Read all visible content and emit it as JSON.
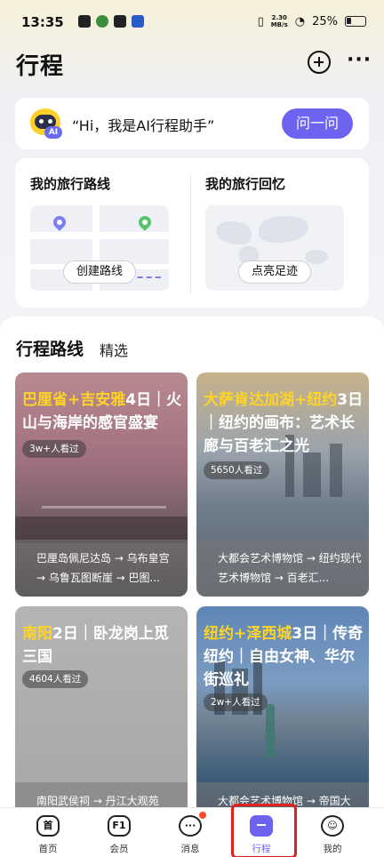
{
  "status_bar": {
    "time": "13:35",
    "speed": "2.30\nMB/s",
    "battery": "25%"
  },
  "header": {
    "title": "行程"
  },
  "ai_assistant": {
    "greeting": "“Hi，我是AI行程助手”",
    "badge": "AI",
    "ask_label": "问一问"
  },
  "trip": {
    "routes": {
      "title": "我的旅行路线",
      "button": "创建路线"
    },
    "memories": {
      "title": "我的旅行回忆",
      "button": "点亮足迹"
    }
  },
  "tabs": {
    "active": "行程路线",
    "other": "精选"
  },
  "guides": [
    {
      "hl": "巴厘省+吉安雅",
      "rest": "4日｜火山与海岸的感官盛宴",
      "views": "3w+人看过",
      "route": "巴厘岛佩尼达岛 → 乌布皇宫 → 乌鲁瓦图断崖 → 巴图..."
    },
    {
      "hl": "大萨肯达加湖+纽约",
      "rest": "3日｜纽约的画布：艺术长廊与百老汇之光",
      "views": "5650人看过",
      "route": "大都会艺术博物馆 → 纽约现代艺术博物馆 → 百老汇..."
    },
    {
      "hl": "南阳",
      "rest": "2日｜卧龙岗上觅三国",
      "views": "4604人看过",
      "route": "南阳武侯祠 → 丹江大观苑"
    },
    {
      "hl": "纽约+泽西城",
      "rest": "3日｜传奇纽约｜自由女神、华尔街巡礼",
      "views": "2w+人看过",
      "route": "大都会艺术博物馆 → 帝国大"
    }
  ],
  "nav": [
    {
      "label": "首页",
      "icon": "home-icon",
      "glyph": "首"
    },
    {
      "label": "会员",
      "icon": "member-icon",
      "glyph": "F1"
    },
    {
      "label": "消息",
      "icon": "message-icon",
      "glyph": "···"
    },
    {
      "label": "行程",
      "icon": "trip-icon",
      "glyph": ""
    },
    {
      "label": "我的",
      "icon": "profile-icon",
      "glyph": "☺"
    }
  ],
  "colors": {
    "accent": "#6c63f0",
    "highlight": "#ffd426",
    "alert": "#e0201a"
  }
}
